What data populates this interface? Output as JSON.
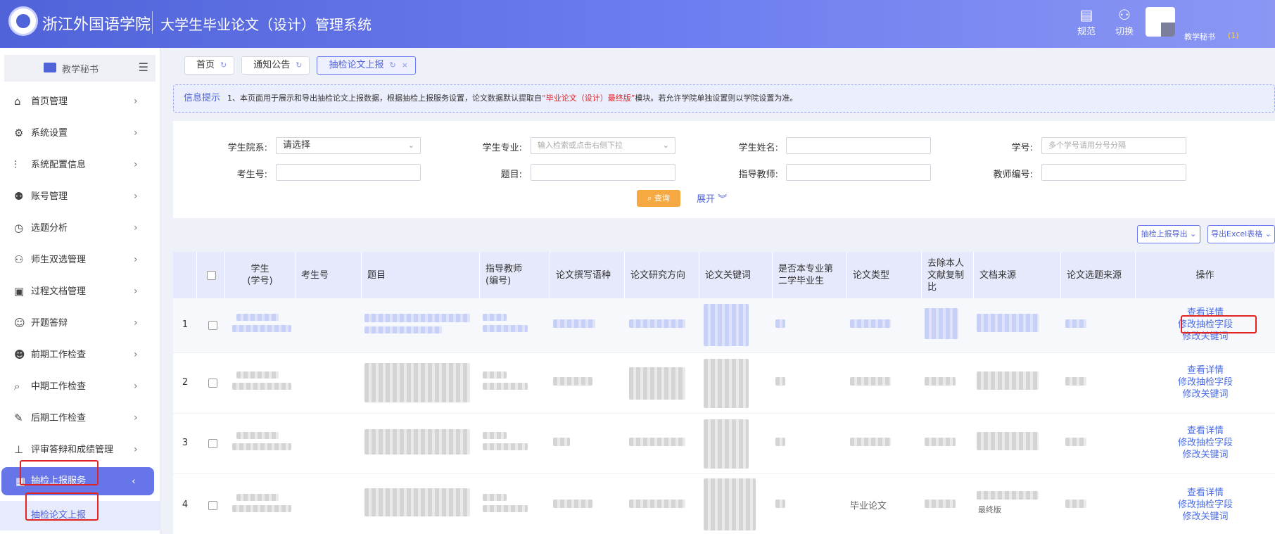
{
  "header": {
    "school_name": "浙江外国语学院",
    "system_name": "大学生毕业论文（设计）管理系统",
    "norms_label": "规范",
    "switch_label": "切换",
    "user_name": "教学秘书",
    "user_count": "(1)"
  },
  "sidebar": {
    "role_label": "教学秘书",
    "items": [
      {
        "label": "首页管理",
        "icon": "home-icon"
      },
      {
        "label": "系统设置",
        "icon": "gear-icon"
      },
      {
        "label": "系统配置信息",
        "icon": "sliders-icon"
      },
      {
        "label": "账号管理",
        "icon": "users-icon"
      },
      {
        "label": "选题分析",
        "icon": "clock-icon"
      },
      {
        "label": "师生双选管理",
        "icon": "people-icon"
      },
      {
        "label": "过程文档管理",
        "icon": "clipboard-icon"
      },
      {
        "label": "开题答辩",
        "icon": "person-icon"
      },
      {
        "label": "前期工作检查",
        "icon": "person-check-icon"
      },
      {
        "label": "中期工作检查",
        "icon": "search-doc-icon"
      },
      {
        "label": "后期工作检查",
        "icon": "edit-doc-icon"
      },
      {
        "label": "评审答辩和成绩管理",
        "icon": "stamp-icon"
      },
      {
        "label": "抽检上报服务",
        "icon": "report-icon"
      }
    ],
    "submenu_label": "抽检论文上报"
  },
  "tabs": [
    {
      "label": "首页"
    },
    {
      "label": "通知公告"
    },
    {
      "label": "抽检论文上报"
    }
  ],
  "info": {
    "label": "信息提示",
    "text_before": "1、本页面用于展示和导出抽检论文上报数据，根据抽检上报服务设置，论文数据默认提取自",
    "highlight": "“毕业论文（设计）最终版”",
    "text_after": "模块。若允许学院单独设置则以学院设置为准。"
  },
  "filters": {
    "college_label": "学生院系:",
    "college_value": "请选择",
    "major_label": "学生专业:",
    "major_placeholder": "输入检索或点击右侧下拉",
    "name_label": "学生姓名:",
    "id_label": "学号:",
    "id_placeholder": "多个学号请用分号分隔",
    "exam_label": "考生号:",
    "title_label": "题目:",
    "advisor_label": "指导教师:",
    "teacher_no_label": "教师编号:",
    "query_label": "查询",
    "expand_label": "展开"
  },
  "toolbar": {
    "export_report_label": "抽检上报导出",
    "export_excel_label": "导出Excel表格"
  },
  "table": {
    "headers": {
      "student": "学生\n(学号)",
      "exam_no": "考生号",
      "title": "题目",
      "advisor": "指导教师\n(编号)",
      "language": "论文撰写语种",
      "direction": "论文研究方向",
      "keywords": "论文关键词",
      "first_degree": "是否本专业第\n二学毕业生",
      "type": "论文类型",
      "dup": "去除本人\n文献复制\n比",
      "source": "文档来源",
      "topic_source": "论文选题来源",
      "actions": "操作"
    },
    "rows": [
      {
        "index": "1",
        "type": "",
        "source": ""
      },
      {
        "index": "2",
        "type": "",
        "source": ""
      },
      {
        "index": "3",
        "type": "",
        "source": ""
      },
      {
        "index": "4",
        "type": "毕业论文",
        "source": "最终版"
      }
    ],
    "action_view": "查看详情",
    "action_edit_fields": "修改抽检字段",
    "action_edit_keywords": "修改关键词"
  }
}
